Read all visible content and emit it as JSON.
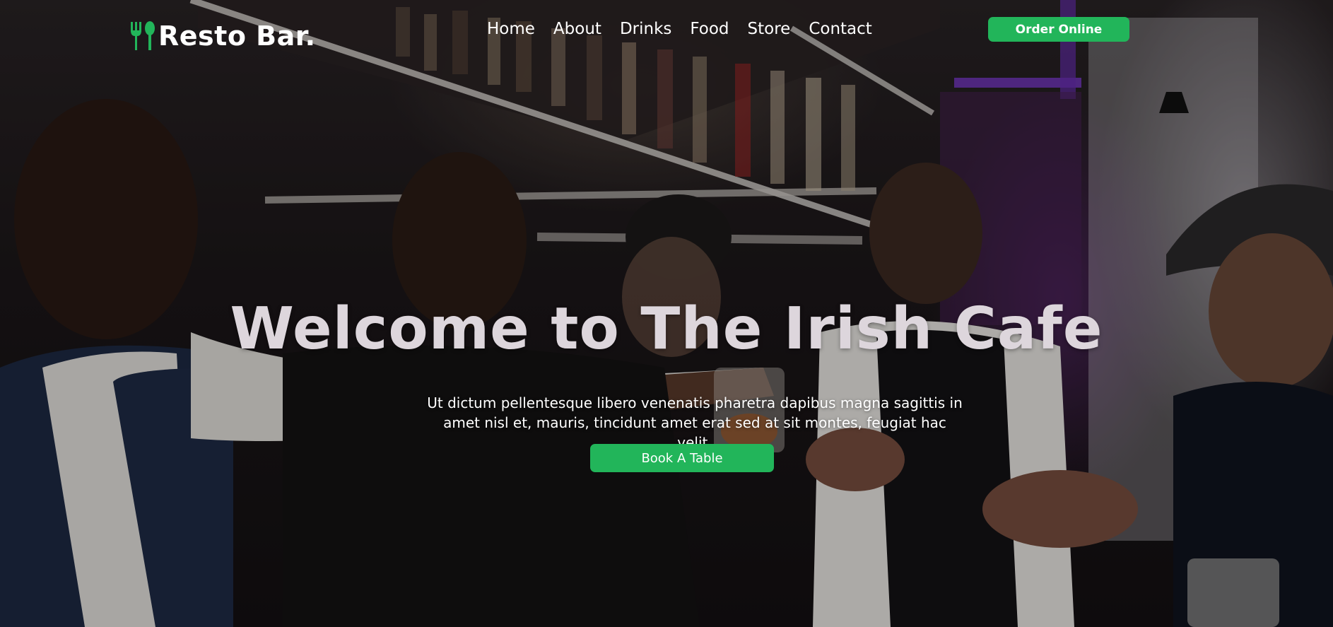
{
  "brand": {
    "name": "Resto Bar.",
    "icon": "fork-spoon-icon",
    "accent_color": "#22b55a"
  },
  "nav": {
    "items": [
      {
        "label": "Home"
      },
      {
        "label": "About"
      },
      {
        "label": "Drinks"
      },
      {
        "label": "Food"
      },
      {
        "label": "Store"
      },
      {
        "label": "Contact"
      }
    ]
  },
  "header": {
    "cta_label": "Order Online"
  },
  "hero": {
    "title": "Welcome to The Irish Cafe",
    "subtitle": "Ut dictum pellentesque libero venenatis pharetra dapibus magna sagittis in amet nisl et, mauris, tincidunt amet erat sed at sit montes, feugiat hac velit.",
    "cta_label": "Book A Table",
    "background_image": "friends-toasting-at-bar-photo"
  },
  "colors": {
    "button": "#22b55a",
    "title_text": "#ddd6dc",
    "nav_text": "#ffffff"
  }
}
